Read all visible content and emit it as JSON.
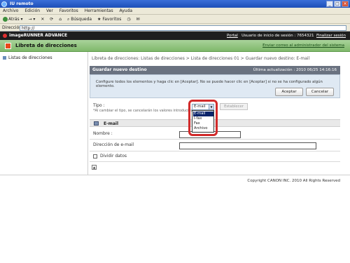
{
  "window": {
    "title": "IU remoto"
  },
  "menu": [
    "Archivo",
    "Edición",
    "Ver",
    "Favoritos",
    "Herramientas",
    "Ayuda"
  ],
  "toolbar": {
    "back": "Atrás",
    "search": "Búsqueda",
    "favorites": "Favoritos"
  },
  "address": {
    "label": "Dirección",
    "value": "http://"
  },
  "brand": {
    "product": "imageRUNNER ADVANCE",
    "portal": "Portal",
    "user_session": "Usuario de inicio de sesión : 7654321",
    "logout": "Finalizar sesión"
  },
  "header": {
    "title": "Libreta de direcciones",
    "mail_admin_link": "Enviar correo al administrador del sistema"
  },
  "sidebar": {
    "items": [
      {
        "label": "Listas de direcciones"
      }
    ]
  },
  "breadcrumb": "Libreta de direcciones: Listas de direcciones > Lista de direcciones 01 > Guardar nuevo destino: E-mail",
  "panel": {
    "title": "Guardar nuevo destino",
    "last_update": "Última actualización : 2010 06/25 14:16:16",
    "message": "Configure todos los elementos y haga clic en [Aceptar]. No se puede hacer clic en [Aceptar] si no se ha configurado algún elemento.",
    "ok_label": "Aceptar",
    "cancel_label": "Cancelar"
  },
  "type_field": {
    "label": "Tipo :",
    "note": "*Al cambiar el tipo, se cancelarán los valores introducidos.",
    "selected": "E-mail",
    "options": [
      "E-mail",
      "I-fax",
      "Fax",
      "Archivo"
    ],
    "set_button": "Establecer"
  },
  "email_section": {
    "title": "E-mail",
    "name_label": "Nombre :",
    "address_label": "Dirección de e-mail",
    "name_value": "",
    "address_value": "",
    "split_label": "Dividir datos"
  },
  "footer": {
    "copyright": "Copyright CANON INC. 2010 All Rights Reserved"
  },
  "colors": {
    "accent_green": "#8cc47a",
    "panel_head": "#6a7280",
    "highlight": "#d12a2a"
  }
}
